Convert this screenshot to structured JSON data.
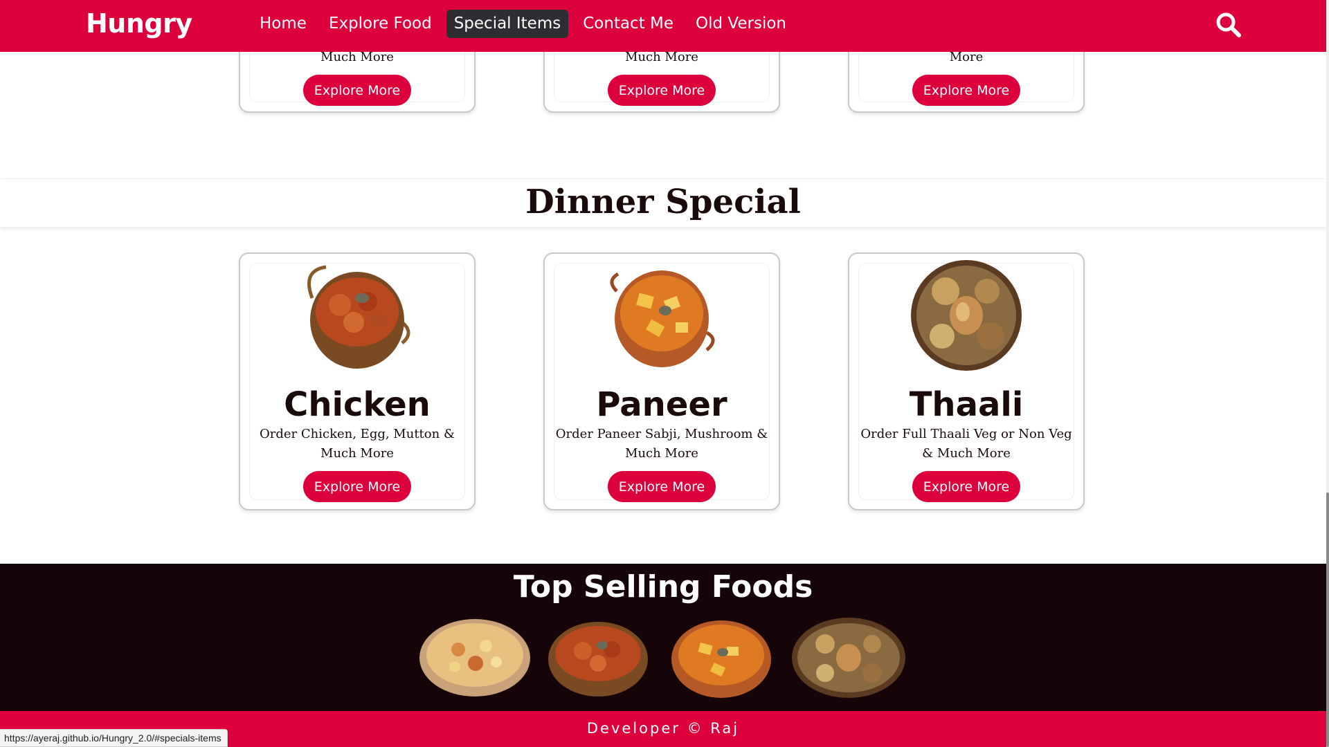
{
  "navbar": {
    "logo": "Hungry",
    "links": [
      {
        "label": "Home",
        "active": false
      },
      {
        "label": "Explore Food",
        "active": false
      },
      {
        "label": "Special Items",
        "active": true
      },
      {
        "label": "Contact Me",
        "active": false
      },
      {
        "label": "Old Version",
        "active": false
      }
    ],
    "search_icon": "search-icon"
  },
  "top_row": [
    {
      "desc": "Much More",
      "button": "Explore More"
    },
    {
      "desc": "Much More",
      "button": "Explore More"
    },
    {
      "desc": "More",
      "button": "Explore More"
    }
  ],
  "dinner_special": {
    "title": "Dinner Special",
    "cards": [
      {
        "title": "Chicken",
        "desc": "Order Chicken, Egg, Mutton & Much More",
        "button": "Explore More",
        "image": "chicken-curry-dish"
      },
      {
        "title": "Paneer",
        "desc": "Order Paneer Sabji, Mushroom & Much More",
        "button": "Explore More",
        "image": "paneer-curry-dish"
      },
      {
        "title": "Thaali",
        "desc": "Order Full Thaali Veg or Non Veg & Much More",
        "button": "Explore More",
        "image": "thaali-platter-dish"
      }
    ]
  },
  "top_selling": {
    "title": "Top Selling Foods",
    "items": [
      "biryani-dish",
      "chicken-curry-dish",
      "paneer-curry-dish",
      "thaali-platter-dish"
    ]
  },
  "footer": {
    "text": "Developer © Raj"
  },
  "status_bar": {
    "url": "https://ayeraj.github.io/Hungry_2.0/#specials-items"
  },
  "colors": {
    "brand": "#dc003c",
    "dark": "#150508",
    "active_nav": "#2e2e32"
  }
}
